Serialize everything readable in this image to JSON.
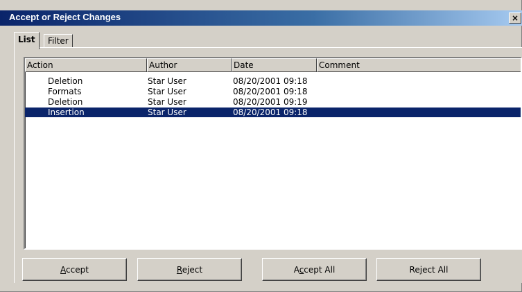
{
  "window": {
    "title": "Accept or Reject Changes",
    "close_glyph": "×"
  },
  "tabs": [
    {
      "label": "List",
      "active": true
    },
    {
      "label": "Filter",
      "active": false
    }
  ],
  "list": {
    "columns": [
      "Action",
      "Author",
      "Date",
      "Comment"
    ],
    "rows": [
      {
        "action": "Deletion",
        "author": "Star User",
        "date": "08/20/2001 09:18",
        "comment": "",
        "selected": false
      },
      {
        "action": "Formats",
        "author": "Star User",
        "date": "08/20/2001 09:18",
        "comment": "",
        "selected": false
      },
      {
        "action": "Deletion",
        "author": "Star User",
        "date": "08/20/2001 09:19",
        "comment": "",
        "selected": false
      },
      {
        "action": "Insertion",
        "author": "Star User",
        "date": "08/20/2001 09:18",
        "comment": "",
        "selected": true
      }
    ]
  },
  "buttons": {
    "accept": {
      "pre": "",
      "mnemonic": "A",
      "post": "ccept"
    },
    "reject": {
      "pre": "",
      "mnemonic": "R",
      "post": "eject"
    },
    "accept_all": {
      "pre": "A",
      "mnemonic": "c",
      "post": "cept All"
    },
    "reject_all": {
      "pre": "Re",
      "mnemonic": "j",
      "post": "ect All"
    }
  },
  "colors": {
    "face": "#d4d0c8",
    "title_gradient_start": "#0a246a",
    "title_gradient_end": "#a6caf0",
    "selection": "#0a246a"
  }
}
